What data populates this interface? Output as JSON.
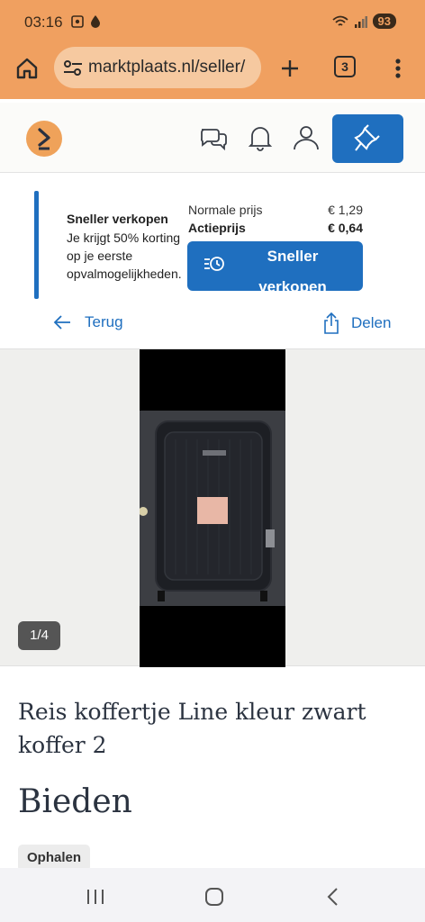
{
  "status_bar": {
    "time": "03:16",
    "battery": "93"
  },
  "browser": {
    "url": "marktplaats.nl/seller/",
    "tab_count": "3"
  },
  "promo": {
    "title": "Sneller verkopen",
    "text": "Je krijgt 50% korting op je eerste opvalmogelijkheden.",
    "normal_label": "Normale prijs",
    "normal_price": "€ 1,29",
    "action_label": "Actieprijs",
    "action_price": "€ 0,64",
    "button_label": "Sneller verkopen"
  },
  "nav": {
    "back": "Terug",
    "share": "Delen"
  },
  "gallery": {
    "counter": "1/4"
  },
  "listing": {
    "title": "Reis koffertje Line kleur zwart koffer 2",
    "price": "Bieden",
    "delivery_badge": "Ophalen"
  },
  "colors": {
    "chrome": "#F0A060",
    "brand_blue": "#1F6FBF",
    "logo": "#EFA25A"
  }
}
